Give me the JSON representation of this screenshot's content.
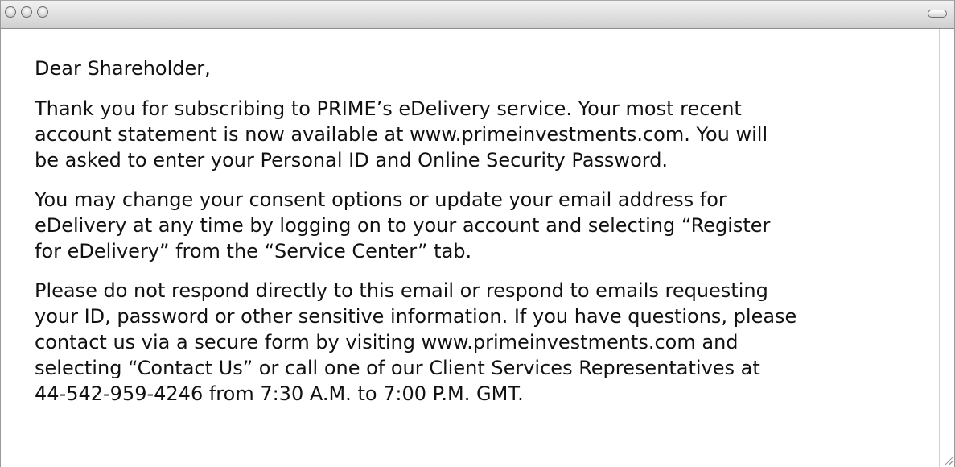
{
  "window": {
    "controls": {
      "close": "close-icon",
      "minimize": "minimize-icon",
      "zoom": "zoom-icon",
      "toolbar_toggle": "toolbar-toggle-icon"
    }
  },
  "message": {
    "greeting": "Dear Shareholder,",
    "paragraphs": [
      "Thank you for subscribing to PRIME’s eDelivery service. Your most recent\naccount statement is now available at www.primeinvestments.com. You will\nbe asked to enter your Personal ID and Online Security Password.",
      "You may change your consent options or update your email address for\neDelivery at any time by logging on to your account and selecting “Register\nfor eDelivery” from the “Service Center” tab.",
      "Please do not respond directly to this email or respond to emails requesting\nyour ID, password or other sensitive information. If you have questions, please\ncontact us via a secure form by visiting www.primeinvestments.com and\nselecting “Contact Us” or call one of our Client Services Representatives at\n44-542-959-4246 from 7:30 A.M. to 7:00 P.M. GMT."
    ]
  }
}
